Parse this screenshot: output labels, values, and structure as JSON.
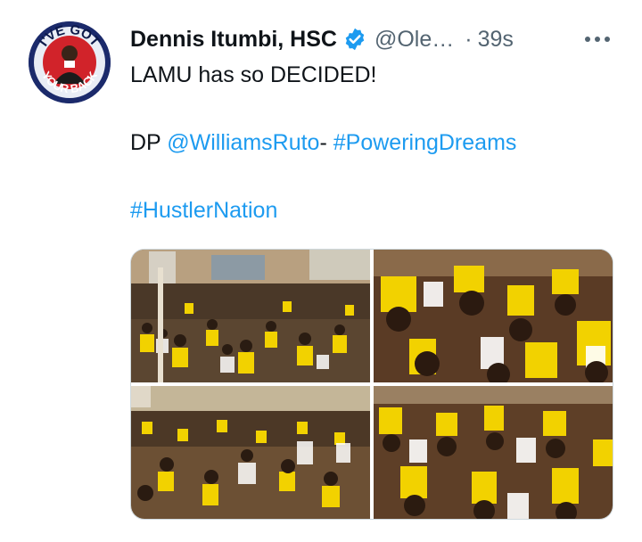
{
  "tweet": {
    "author_name": "Dennis Itumbi, HSC",
    "handle": "@Ole…",
    "separator": "·",
    "time": "39s",
    "avatar_badge": {
      "top_text": "I'VE GOT",
      "bottom_text": "YOUR BACK"
    },
    "line1": "LAMU has so DECIDED!",
    "line2": {
      "prefix": "DP ",
      "mention": "@WilliamsRuto",
      "dash": "- ",
      "hashtag": "#PoweringDreams"
    },
    "line3": {
      "hashtag": "#HustlerNation"
    },
    "photo_count": 4
  },
  "icons": {
    "verified": "verified-badge-icon",
    "more": "more-options-icon"
  },
  "colors": {
    "link": "#1d9bf0",
    "text": "#0f1419",
    "secondary": "#536471",
    "verified": "#1d9bf0",
    "crowd_yellow": "#f2d200",
    "avatar_blue": "#1b2a6b",
    "avatar_red": "#d1232a"
  }
}
